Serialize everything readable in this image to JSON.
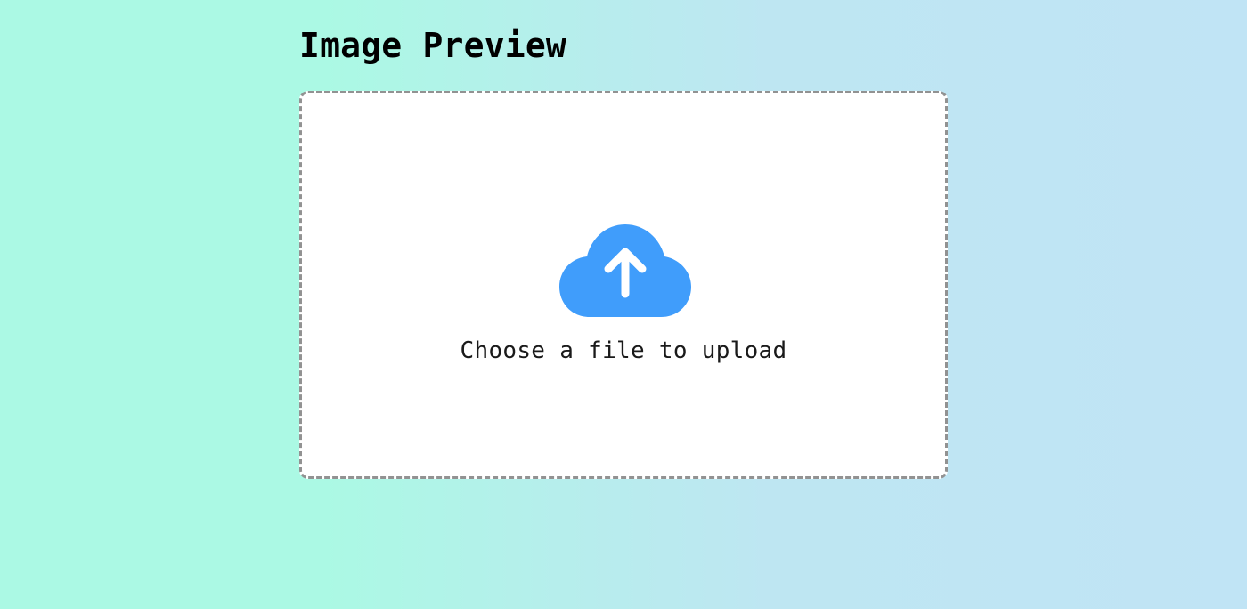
{
  "page": {
    "title": "Image Preview"
  },
  "upload": {
    "label": "Choose a file to upload",
    "icon": "cloud-upload-icon",
    "icon_color": "#409dfb",
    "border_color": "#929292"
  },
  "theme": {
    "background_left": "#abf9e4",
    "background_right": "#c0e4f5"
  }
}
